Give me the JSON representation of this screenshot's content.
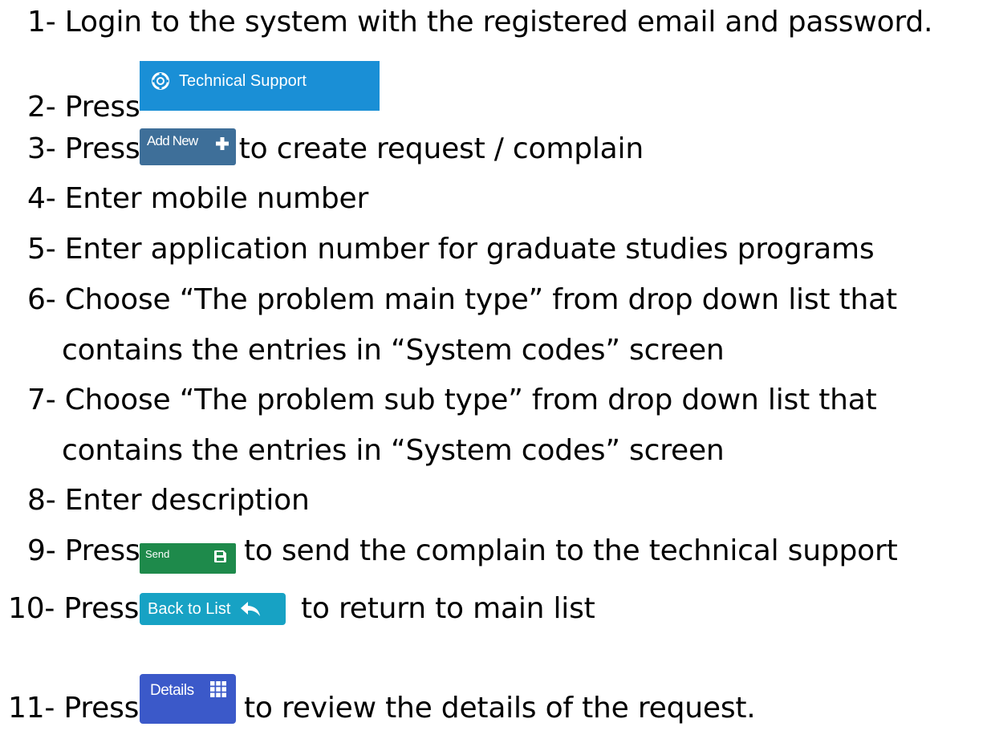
{
  "steps": [
    {
      "num": "1-",
      "text": "Login to the system with the registered email and password."
    },
    {
      "num": "2-",
      "text": "Press"
    },
    {
      "num": "3-",
      "text": "Press",
      "after": "to create request / complain"
    },
    {
      "num": "4-",
      "text": "Enter mobile number"
    },
    {
      "num": "5-",
      "text": "Enter application number for graduate studies programs"
    },
    {
      "num": "6-",
      "text": "Choose “The problem main type” from drop down list that",
      "cont": "contains the entries in “System codes” screen"
    },
    {
      "num": "7-",
      "text": "Choose “The problem sub type” from drop down list that",
      "cont": "contains the entries in “System codes” screen"
    },
    {
      "num": "8-",
      "text": "Enter description"
    },
    {
      "num": "9-",
      "text": "Press",
      "after": "to send the complain to the technical support"
    },
    {
      "num": "10-",
      "text": "Press",
      "after": "to return to main list"
    },
    {
      "num": "11-",
      "text": "Press",
      "after": "to review the details of the request."
    }
  ],
  "buttons": {
    "technical_support": {
      "label": "Technical Support",
      "icon": "lifebuoy-icon",
      "color": "#1a8fd6"
    },
    "add_new": {
      "label": "Add New",
      "icon": "plus-icon",
      "color": "#3e6f99"
    },
    "send": {
      "label": "Send",
      "icon": "save-icon",
      "color": "#1e8a4b"
    },
    "back_to_list": {
      "label": "Back to List",
      "icon": "reply-arrow-icon",
      "color": "#17a2c4"
    },
    "details": {
      "label": "Details",
      "icon": "grid-icon",
      "color": "#3b59c9"
    }
  }
}
